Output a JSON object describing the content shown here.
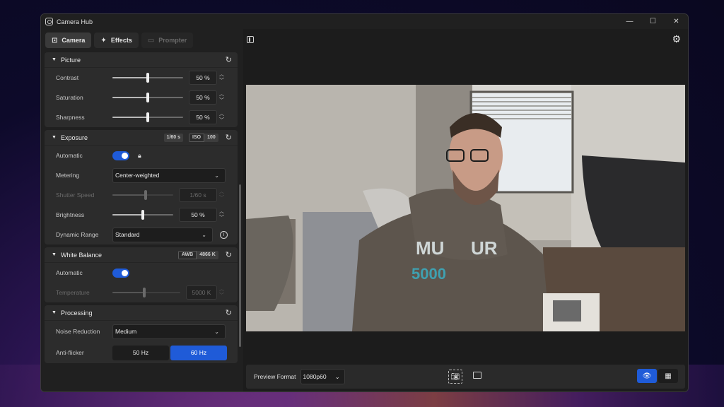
{
  "window": {
    "title": "Camera Hub"
  },
  "tabs": [
    {
      "label": "Camera",
      "icon": "camera-icon"
    },
    {
      "label": "Effects",
      "icon": "magic-wand-icon"
    },
    {
      "label": "Prompter",
      "icon": "prompter-icon"
    }
  ],
  "picture": {
    "title": "Picture",
    "contrast": {
      "label": "Contrast",
      "value": "50 %",
      "level": 0.5
    },
    "saturation": {
      "label": "Saturation",
      "value": "50 %",
      "level": 0.5
    },
    "sharpness": {
      "label": "Sharpness",
      "value": "50 %",
      "level": 0.5
    }
  },
  "exposure": {
    "title": "Exposure",
    "shutter_badge": "1/60 s",
    "iso_key": "ISO",
    "iso_value": "100",
    "automatic_label": "Automatic",
    "metering_label": "Metering",
    "metering_value": "Center-weighted",
    "shutter": {
      "label": "Shutter Speed",
      "value": "1/60 s",
      "level": 0.55
    },
    "brightness": {
      "label": "Brightness",
      "value": "50 %",
      "level": 0.5
    },
    "dynamic_range_label": "Dynamic Range",
    "dynamic_range_value": "Standard"
  },
  "white_balance": {
    "title": "White Balance",
    "awb_key": "AWB",
    "awb_value": "4866 K",
    "automatic_label": "Automatic",
    "temperature": {
      "label": "Temperature",
      "value": "5000 K",
      "level": 0.47
    }
  },
  "processing": {
    "title": "Processing",
    "noise_label": "Noise Reduction",
    "noise_value": "Medium",
    "antiflicker_label": "Anti-flicker",
    "antiflicker_options": [
      "50 Hz",
      "60 Hz"
    ],
    "antiflicker_selected": "60 Hz"
  },
  "bottombar": {
    "preview_format_label": "Preview Format",
    "preview_format_value": "1080p60"
  },
  "colors": {
    "accent": "#1f5bd8"
  }
}
